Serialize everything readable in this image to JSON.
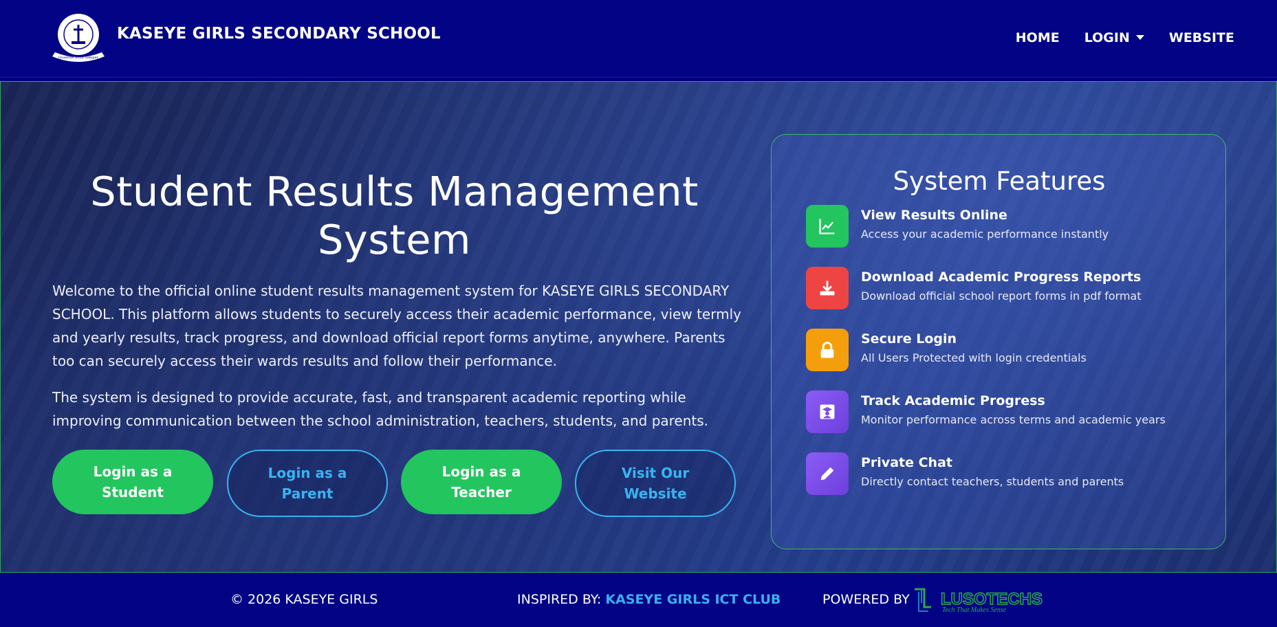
{
  "navbar": {
    "brand": "KASEYE GIRLS SECONDARY SCHOOL",
    "logo_top_text": "Kaseye Girls Sec. School",
    "logo_motto": "Quaerite Bona Semper",
    "items": [
      {
        "label": "HOME"
      },
      {
        "label": "LOGIN"
      },
      {
        "label": "WEBSITE"
      }
    ]
  },
  "hero": {
    "title": "Student Results Management System",
    "paragraph1": "Welcome to the official online student results management system for KASEYE GIRLS SECONDARY SCHOOL. This platform allows students to securely access their academic performance, view termly and yearly results, track progress, and download official report forms anytime, anywhere. Parents too can securely access their wards results and follow their performance.",
    "paragraph2": "The system is designed to provide accurate, fast, and transparent academic reporting while improving communication between the school administration, teachers, students, and parents.",
    "buttons": [
      {
        "label": "Login as a Student"
      },
      {
        "label": "Login as a Parent"
      },
      {
        "label": "Login as a Teacher"
      },
      {
        "label": "Visit Our Website"
      }
    ]
  },
  "features": {
    "title": "System Features",
    "items": [
      {
        "icon": "chart-line-icon",
        "color": "#22c55e",
        "title": "View Results Online",
        "desc": "Access your academic performance instantly"
      },
      {
        "icon": "download-icon",
        "color": "#ef4444",
        "title": "Download Academic Progress Reports",
        "desc": "Download official school report forms in pdf format"
      },
      {
        "icon": "lock-icon",
        "color": "#f59e0b",
        "title": "Secure Login",
        "desc": "All Users Protected with login credentials"
      },
      {
        "icon": "graduate-icon",
        "color": "#7c4de8",
        "title": "Track Academic Progress",
        "desc": "Monitor performance across terms and academic years"
      },
      {
        "icon": "pencil-icon",
        "color": "#7c4de8",
        "title": "Private Chat",
        "desc": "Directly contact teachers, students and parents"
      }
    ]
  },
  "footer": {
    "copyright": "© 2026 KASEYE GIRLS",
    "inspired_label": "INSPIRED BY:",
    "inspired_name": "KASEYE GIRLS ICT CLUB",
    "powered_label": "POWERED BY",
    "powered_logo_text": "LUSOTECHS",
    "powered_logo_tagline": "Tech That Makes Sense"
  },
  "colors": {
    "navbar": "#020485",
    "accent_green": "#22c55e",
    "accent_blue": "#38b4f0"
  }
}
